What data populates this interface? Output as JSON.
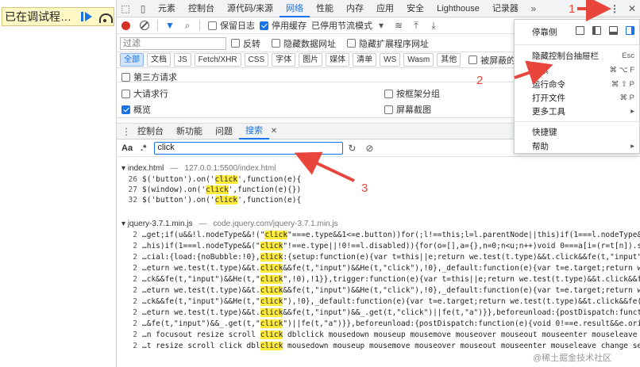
{
  "page": {
    "paused_text": "已在调试程…"
  },
  "tabs": [
    "元素",
    "控制台",
    "源代码/来源",
    "网络",
    "性能",
    "内存",
    "应用",
    "安全",
    "Lighthouse",
    "记录器"
  ],
  "active_tab": "网络",
  "toolbar": {
    "preserve_log": "保留日志",
    "disable_cache": "停用缓存",
    "throttle": "已停用节流模式"
  },
  "filter": {
    "placeholder": "过滤",
    "invert": "反转",
    "hide_data_urls": "隐藏数据网址",
    "hide_ext_urls": "隐藏扩展程序网址"
  },
  "types": [
    "全部",
    "文档",
    "JS",
    "Fetch/XHR",
    "CSS",
    "字体",
    "图片",
    "媒体",
    "清单",
    "WS",
    "Wasm",
    "其他"
  ],
  "blocked_cookies": "被屏蔽的响应 Cook",
  "third_party": "第三方请求",
  "options": {
    "large_rows": "大请求行",
    "group_by_frame": "按框架分组",
    "overview": "概览",
    "screenshots": "屏幕截图"
  },
  "drawer_tabs": [
    "控制台",
    "新功能",
    "问题",
    "搜索"
  ],
  "search": {
    "aa": "Aa",
    "regex": ".*",
    "query": "click"
  },
  "results": {
    "file1": {
      "name": "index.html",
      "url": "127.0.0.1:5500/index.html",
      "lines": [
        {
          "n": "26",
          "pre": "$('button').on('",
          "hit": "click",
          "post": "',function(e){"
        },
        {
          "n": "27",
          "pre": "$(window).on('",
          "hit": "click",
          "post": "',function(e){})"
        },
        {
          "n": "32",
          "pre": "$('button').on('",
          "hit": "click",
          "post": "',function(e){"
        }
      ]
    },
    "file2": {
      "name": "jquery-3.7.1.min.js",
      "url": "code.jquery.com/jquery-3.7.1.min.js",
      "lines": [
        {
          "n": "2",
          "pre": "…get;if(u&&!l.nodeType&&!(\"",
          "hit": "click",
          "post": "\"===e.type&&1<=e.button))for(;l!==this;l=l.parentNode||this)if(1===l.nodeType&&(\"click\"!==e.type||!0!==l.disabled))"
        },
        {
          "n": "2",
          "pre": "…his)if(1===l.nodeType&&(\"",
          "hit": "click",
          "post": "\"!==e.type||!0!==l.disabled)){for(o=[],a={},n=0;n<u;n++)void 0===a[i=(r=t[n]).selector+\" \"]&&(a[i]=r.needsContext?-1"
        },
        {
          "n": "2",
          "pre": "…cial:{load:{noBubble:!0},",
          "hit": "click",
          "post": ":{setup:function(e){var t=this||e;return we.test(t.type)&&t.click&&fe(t,\"input\")&&He(t,\"click\",!0),!1},trigger:function(e){v"
        },
        {
          "n": "2",
          "pre": "…eturn we.test(t.type)&&t.",
          "hit": "click",
          "post": "&&fe(t,\"input\")&&He(t,\"click\"),!0},_default:function(e){var t=e.target;return we.test(t.type)&&t.click&&fe(t,\"input\")&&He("
        },
        {
          "n": "2",
          "pre": "…ck&&fe(t,\"input\")&&He(t,\"",
          "hit": "click",
          "post": "\",!0),!1}},trigger:function(e){var t=this||e;return we.test(t.type)&&t.click&&fe(t,\"input\")&&He(t,\"click\"),!0},_default:function"
        },
        {
          "n": "2",
          "pre": "…eturn we.test(t.type)&&t.",
          "hit": "click",
          "post": "&&fe(t,\"input\")&&He(t,\"click\"),!0},_default:function(e){var t=e.target;return we.test(t.type)&&t.click&&fe(t,\"input\")&&He(t,"
        },
        {
          "n": "2",
          "pre": "…ck&&fe(t,\"input\")&&He(t,\"",
          "hit": "click",
          "post": "\"),!0},_default:function(e){var t=e.target;return we.test(t.type)&&t.click&&fe(t,\"input\")&&_.get(t,\"click\")||fe(t,\"a\")}},befo"
        },
        {
          "n": "2",
          "pre": "…eturn we.test(t.type)&&t.",
          "hit": "click",
          "post": "&&fe(t,\"input\")&&_.get(t,\"click\")||fe(t,\"a\")}},beforeunload:{postDispatch:function(e){void 0!==e.result&&e.originalEvent&&("
        },
        {
          "n": "2",
          "pre": "…&fe(t,\"input\")&&_.get(t,\"",
          "hit": "click",
          "post": "\")||fe(t,\"a\")}},beforeunload:{postDispatch:function(e){void 0!==e.result&&e.originalEvent&&(e.originalEvent.returnValu"
        },
        {
          "n": "2",
          "pre": "…n focusout resize scroll ",
          "hit": "click",
          "post": " dblclick mousedown mouseup mousemove mouseover mouseout mouseenter mouseleave change select submit k"
        },
        {
          "n": "2",
          "pre": "…t resize scroll click dbl",
          "hit": "click",
          "post": " mousedown mouseup mousemove mouseover mouseout mouseenter mouseleave change select submit keydown k"
        }
      ]
    }
  },
  "menu": {
    "dock_label": "停靠侧",
    "items": [
      {
        "label": "隐藏控制台抽屉栏",
        "key": "Esc"
      },
      {
        "label": "搜索",
        "key": "⌘ ⌥ F"
      },
      {
        "label": "运行命令",
        "key": "⌘ ⇧ P"
      },
      {
        "label": "打开文件",
        "key": "⌘ P"
      },
      {
        "label": "更多工具",
        "key": "▸"
      },
      {
        "label": "快捷键",
        "key": ""
      },
      {
        "label": "帮助",
        "key": "▸"
      }
    ]
  },
  "annotations": {
    "a1": "1",
    "a2": "2",
    "a3": "3"
  },
  "colors": {
    "accent": "#1a73e8",
    "highlight": "#ffeb3b",
    "annotation": "#e8453c"
  },
  "watermark": "@稀土掘金技术社区"
}
